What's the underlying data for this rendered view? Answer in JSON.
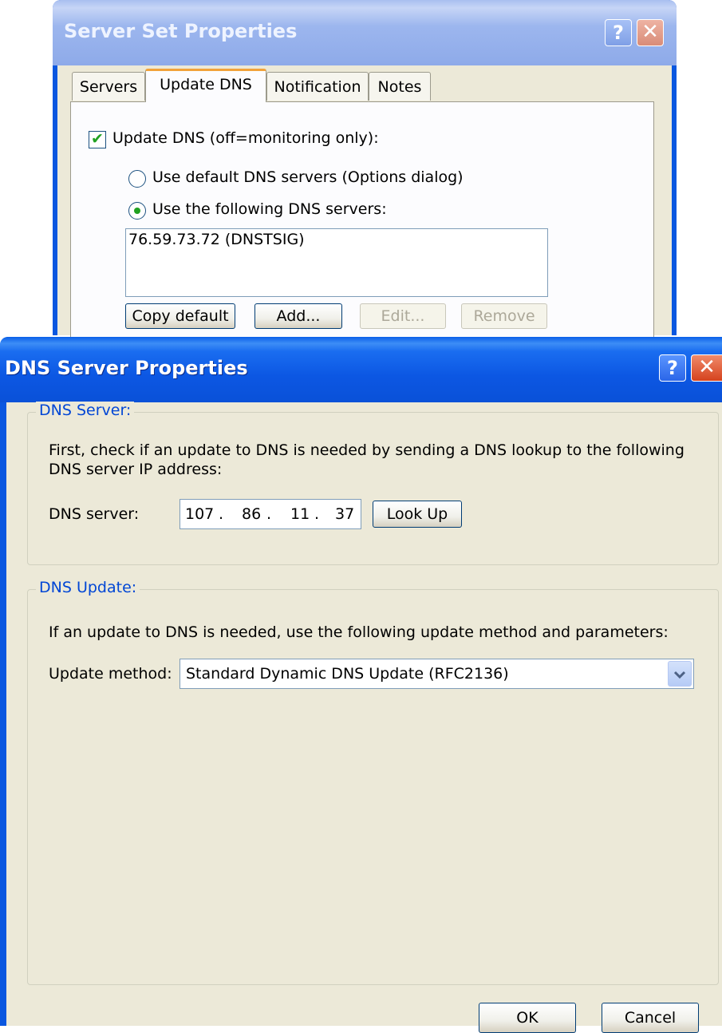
{
  "server_set_dialog": {
    "title": "Server Set Properties",
    "help_glyph": "?",
    "close_glyph": "✕",
    "tabs": [
      "Servers",
      "Update DNS",
      "Notification",
      "Notes"
    ],
    "active_tab": "Update DNS",
    "update_dns_checkbox": {
      "label": "Update DNS  (off=monitoring only):",
      "checked": true,
      "glyph": "✔"
    },
    "radio_default": {
      "label": "Use default DNS servers (Options dialog)",
      "selected": false
    },
    "radio_following": {
      "label": "Use the following DNS servers:",
      "selected": true
    },
    "dns_servers_list": [
      "76.59.73.72 (DNSTSIG)"
    ],
    "buttons": {
      "copy_default": "Copy default",
      "add": "Add...",
      "edit": "Edit...",
      "remove": "Remove"
    }
  },
  "dns_server_dialog": {
    "title": "DNS Server Properties",
    "help_glyph": "?",
    "close_glyph": "✕",
    "dns_server_group": {
      "legend": "DNS Server:",
      "description_line1": "First, check if an update to DNS is needed by sending a DNS lookup to the following",
      "description_line2": "DNS server IP address:",
      "field_label": "DNS server:",
      "ip_octets": [
        "107",
        "86",
        "11",
        "37"
      ],
      "ip_separator": ".",
      "lookup_button": "Look Up"
    },
    "dns_update_group": {
      "legend": "DNS Update:",
      "description": "If an update to DNS is needed, use the following update method and parameters:",
      "method_label": "Update method:",
      "method_value": "Standard Dynamic DNS Update (RFC2136)"
    },
    "ok_button": "OK",
    "cancel_button": "Cancel"
  },
  "colors": {
    "title_active": "#0a57e0",
    "client_bg": "#ece9d8",
    "group_legend": "#0046d5",
    "check_mark": "#21a121"
  }
}
